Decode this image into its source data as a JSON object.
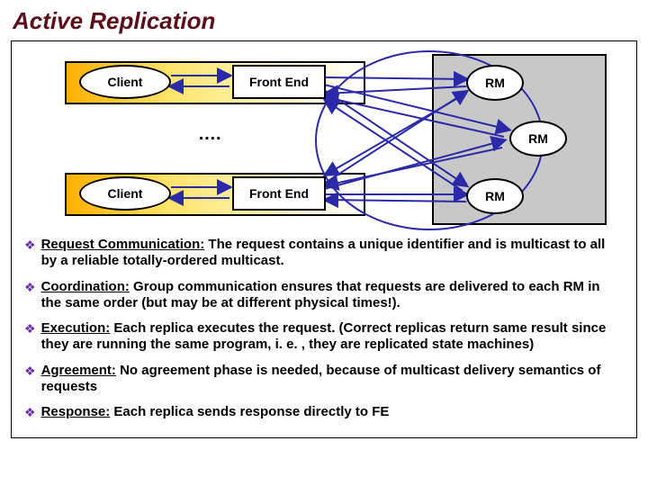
{
  "title": "Active Replication",
  "diagram": {
    "client_label": "Client",
    "frontend_label": "Front End",
    "rm_label": "RM",
    "ellipsis": "…."
  },
  "bullets": [
    {
      "lead": "Request Communication:",
      "body": " The request contains a unique identifier and is multicast to all by a reliable totally-ordered multicast."
    },
    {
      "lead": "Coordination:",
      "body": " Group communication ensures that requests are delivered to each RM in the same order (but may be at different physical times!)."
    },
    {
      "lead": "Execution:",
      "body": " Each replica executes the request.  (Correct replicas return same result since they are running the same program, i. e. , they are replicated state machines)"
    },
    {
      "lead": "Agreement:",
      "body": " No agreement phase is needed, because of multicast delivery semantics of requests"
    },
    {
      "lead": "Response:",
      "body": " Each replica sends response directly to FE"
    }
  ]
}
